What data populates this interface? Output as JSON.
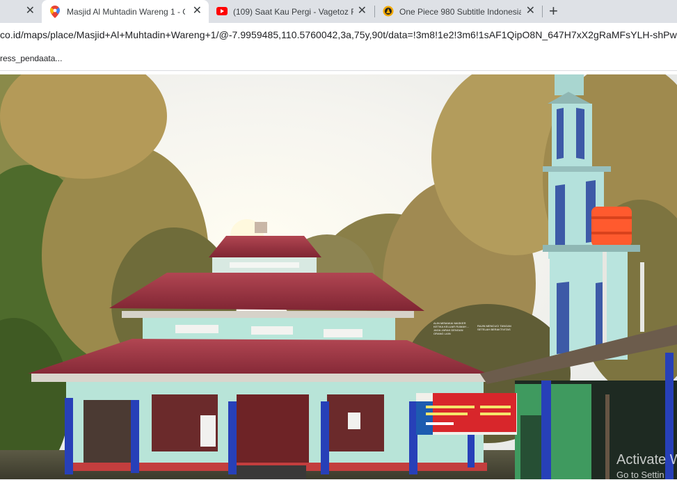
{
  "tabs": [
    {
      "title": "",
      "close": "✕"
    },
    {
      "title": "Masjid Al Muhtadin Wareng 1 - G",
      "close": "✕",
      "icon": "google-maps-pin-icon"
    },
    {
      "title": "(109) Saat Kau Pergi - Vagetoz Ft",
      "close": "✕",
      "icon": "youtube-icon"
    },
    {
      "title": "One Piece 980 Subtitle Indonesia",
      "close": "✕",
      "icon": "anime-site-icon"
    }
  ],
  "new_tab_label": "+",
  "address": "co.id/maps/place/Masjid+Al+Muhtadin+Wareng+1/@-7.9959485,110.5760042,3a,75y,90t/data=!3m8!1e2!3m6!1sAF1QipO8N_647H7xX2gRaMFsYLH-shPw...",
  "bookmark": "ress_pendaata...",
  "banner": {
    "left": "ALIN MEMAKAI MASKER KETIKA KELUAR RUMAH ... JAGA JARAK DENGAN ORANG LAIN",
    "right": "RAJIN MENCUCI TANGAN SETELAH BERAKTIVITAS"
  },
  "watermark": {
    "title": "Activate W",
    "subtitle": "Go to Settin"
  },
  "colors": {
    "tabbar": "#dee1e6",
    "pillar": "#2740b8",
    "wall": "#b9e6da",
    "roof": "#9a2f3a"
  }
}
